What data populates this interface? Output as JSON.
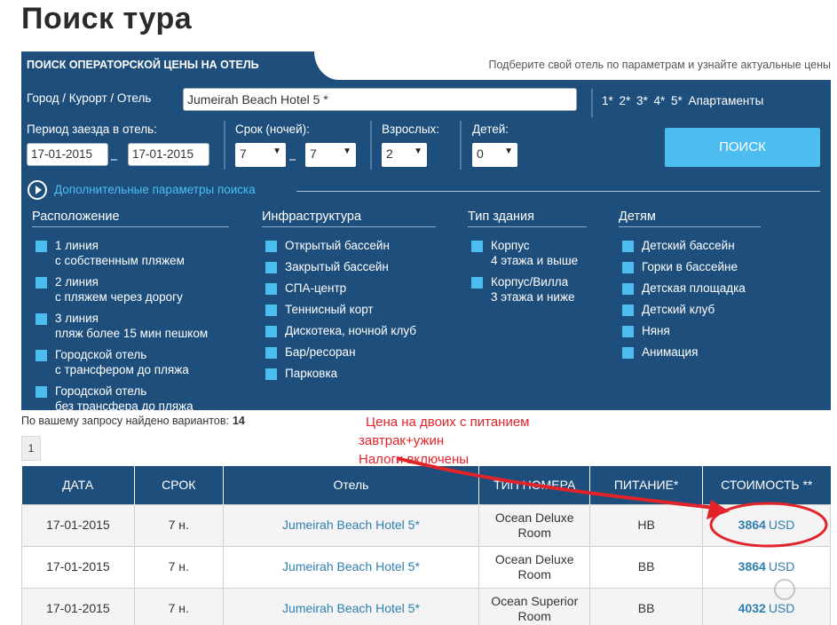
{
  "page": {
    "title": "Поиск тура"
  },
  "panel": {
    "tab_title": "ПОИСК ОПЕРАТОРСКОЙ ЦЕНЫ НА ОТЕЛЬ",
    "hint": "Подберите свой отель по параметрам и узнайте актуальные цены",
    "city_label": "Город / Курорт / Отель",
    "hotel_value": "Jumeirah Beach Hotel 5 *",
    "stars": "1*  2*  3*  4*  5*  Апартаменты",
    "period_label": "Период заезда в отель:",
    "date_from": "17-01-2015",
    "date_to": "17-01-2015",
    "nights_label": "Срок (ночей):",
    "nights_from": "7",
    "nights_to": "7",
    "adults_label": "Взрослых:",
    "adults_value": "2",
    "children_label": "Детей:",
    "children_value": "0",
    "search_button": "ПОИСК",
    "advanced_link": "Дополнительные параметры поиска"
  },
  "filters": {
    "location": {
      "title": "Расположение",
      "items": [
        "1 линия\nс собственным пляжем",
        "2 линия\nс пляжем через дорогу",
        "3 линия\nпляж более 15 мин пешком",
        "Городской отель\nс трансфером до пляжа",
        "Городской отель\nбез трансфера до пляжа"
      ]
    },
    "infrastructure": {
      "title": "Инфраструктура",
      "items": [
        "Открытый бассейн",
        "Закрытый бассейн",
        "СПА-центр",
        "Теннисный корт",
        "Дискотека, ночной клуб",
        "Бар/ресоран",
        "Парковка"
      ]
    },
    "building": {
      "title": "Тип здания",
      "items": [
        "Корпус\n4 этажа и выше",
        "Корпус/Вилла\n3 этажа и ниже"
      ]
    },
    "children": {
      "title": "Детям",
      "items": [
        "Детский бассейн",
        "Горки в бассейне",
        "Детская площадка",
        "Детский клуб",
        "Няня",
        "Анимация"
      ]
    },
    "checkbox_color": "#4dbdf0"
  },
  "results": {
    "found_label": "По вашему запросу найдено вариантов:",
    "found_count": "14",
    "page": "1",
    "columns": [
      "ДАТА",
      "СРОК",
      "Отель",
      "ТИП НОМЕРА",
      "ПИТАНИЕ*",
      "СТОИМОСТЬ **"
    ],
    "rows": [
      {
        "date": "17-01-2015",
        "nights": "7 н.",
        "hotel": "Jumeirah Beach Hotel 5*",
        "room": "Ocean Deluxe\nRoom",
        "meal": "HB",
        "price": "3864",
        "currency": "USD"
      },
      {
        "date": "17-01-2015",
        "nights": "7 н.",
        "hotel": "Jumeirah Beach Hotel 5*",
        "room": "Ocean Deluxe\nRoom",
        "meal": "BB",
        "price": "3864",
        "currency": "USD"
      },
      {
        "date": "17-01-2015",
        "nights": "7 н.",
        "hotel": "Jumeirah Beach Hotel 5*",
        "room": "Ocean Superior\nRoom",
        "meal": "BB",
        "price": "4032",
        "currency": "USD"
      }
    ]
  },
  "annotation": {
    "line1": "Цена на двоих с питанием",
    "line2": "завтрак+ужин",
    "line3": "Налоги включены",
    "color": "#e3232a"
  },
  "colors": {
    "panel": "#1e4f7c",
    "accent": "#4dbdf0",
    "link": "#2f7fb0"
  }
}
